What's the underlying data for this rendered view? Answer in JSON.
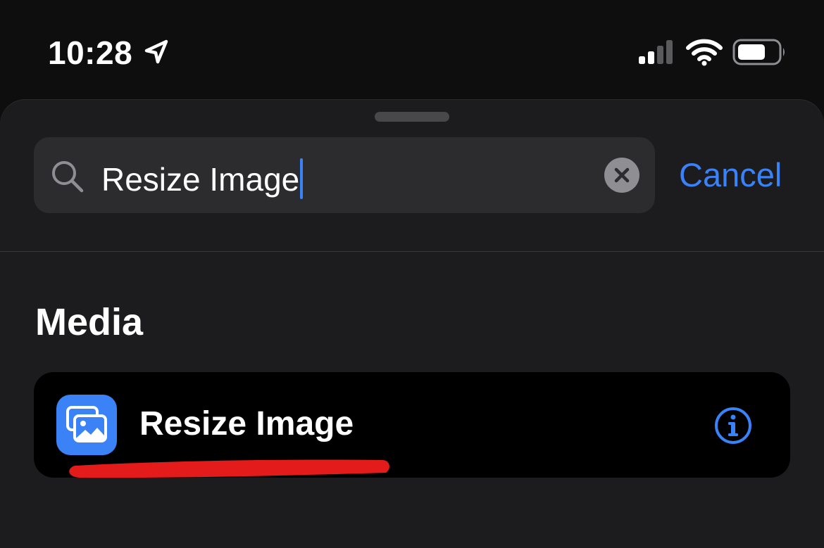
{
  "status_bar": {
    "time": "10:28",
    "icons": [
      "location-arrow-icon",
      "cellular-signal-icon",
      "wifi-icon",
      "battery-icon"
    ]
  },
  "search": {
    "query": "Resize Image",
    "cancel_label": "Cancel"
  },
  "section": {
    "title": "Media"
  },
  "result": {
    "label": "Resize Image",
    "icon": "photos-icon"
  },
  "colors": {
    "accent": "#3a82f7",
    "sheet_background": "#1c1c1e",
    "search_background": "#2c2c2f",
    "card_background": "#000000",
    "annotation": "#e31b1b"
  }
}
